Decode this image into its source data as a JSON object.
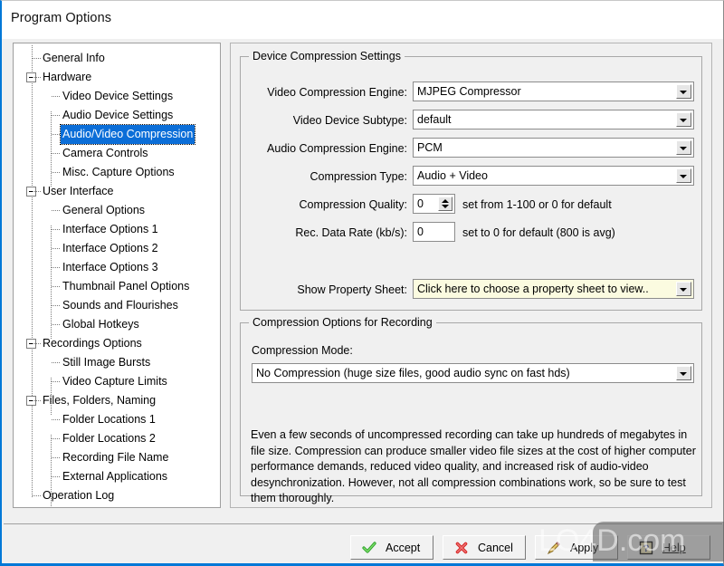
{
  "window": {
    "title": "Program Options",
    "accent_color": "#0078d7"
  },
  "tree": {
    "selected_color": "#0b6ed8",
    "items": [
      {
        "label": "General Info",
        "level": 0,
        "expander": false,
        "selected": false
      },
      {
        "label": "Hardware",
        "level": 0,
        "expander": true,
        "selected": false
      },
      {
        "label": "Video Device Settings",
        "level": 1,
        "expander": false,
        "selected": false
      },
      {
        "label": "Audio Device Settings",
        "level": 1,
        "expander": false,
        "selected": false
      },
      {
        "label": "Audio/Video Compression",
        "level": 1,
        "expander": false,
        "selected": true
      },
      {
        "label": "Camera Controls",
        "level": 1,
        "expander": false,
        "selected": false
      },
      {
        "label": "Misc. Capture Options",
        "level": 1,
        "expander": false,
        "selected": false
      },
      {
        "label": "User Interface",
        "level": 0,
        "expander": true,
        "selected": false
      },
      {
        "label": "General Options",
        "level": 1,
        "expander": false,
        "selected": false
      },
      {
        "label": "Interface Options 1",
        "level": 1,
        "expander": false,
        "selected": false
      },
      {
        "label": "Interface Options 2",
        "level": 1,
        "expander": false,
        "selected": false
      },
      {
        "label": "Interface Options 3",
        "level": 1,
        "expander": false,
        "selected": false
      },
      {
        "label": "Thumbnail Panel Options",
        "level": 1,
        "expander": false,
        "selected": false
      },
      {
        "label": "Sounds and Flourishes",
        "level": 1,
        "expander": false,
        "selected": false
      },
      {
        "label": "Global Hotkeys",
        "level": 1,
        "expander": false,
        "selected": false
      },
      {
        "label": "Recordings Options",
        "level": 0,
        "expander": true,
        "selected": false
      },
      {
        "label": "Still Image Bursts",
        "level": 1,
        "expander": false,
        "selected": false
      },
      {
        "label": "Video Capture Limits",
        "level": 1,
        "expander": false,
        "selected": false
      },
      {
        "label": "Files, Folders, Naming",
        "level": 0,
        "expander": true,
        "selected": false
      },
      {
        "label": "Folder Locations 1",
        "level": 1,
        "expander": false,
        "selected": false
      },
      {
        "label": "Folder Locations 2",
        "level": 1,
        "expander": false,
        "selected": false
      },
      {
        "label": "Recording File Name",
        "level": 1,
        "expander": false,
        "selected": false
      },
      {
        "label": "External Applications",
        "level": 1,
        "expander": false,
        "selected": false
      },
      {
        "label": "Operation Log",
        "level": 0,
        "expander": false,
        "selected": false
      }
    ]
  },
  "device_group": {
    "title": "Device Compression Settings",
    "video_engine": {
      "label": "Video Compression Engine:",
      "value": "MJPEG Compressor"
    },
    "video_subtype": {
      "label": "Video Device Subtype:",
      "value": "default"
    },
    "audio_engine": {
      "label": "Audio Compression Engine:",
      "value": "PCM"
    },
    "compression_type": {
      "label": "Compression Type:",
      "value": "Audio + Video"
    },
    "quality": {
      "label": "Compression Quality:",
      "value": "0",
      "hint": "set from 1-100 or 0 for default"
    },
    "data_rate": {
      "label": "Rec. Data Rate (kb/s):",
      "value": "0",
      "hint": "set to 0 for default (800 is avg)"
    },
    "property_sheet": {
      "label": "Show Property Sheet:",
      "value": "Click here to choose a property sheet to view..",
      "background_color": "#fbfbe0"
    }
  },
  "compression_group": {
    "title": "Compression Options for Recording",
    "mode_label": "Compression Mode:",
    "mode_value": "No Compression (huge size files, good audio sync on fast hds)",
    "description": "Even a few seconds of uncompressed recording can take up hundreds of megabytes in file size.  Compression can produce smaller video file sizes at the cost of higher computer performance demands, reduced video quality, and increased risk of audio-video desynchronization.  However, not all compression combinations work, so be sure to test them thoroughly."
  },
  "footer": {
    "accept": "Accept",
    "cancel": "Cancel",
    "apply": "Apply",
    "help": "Help"
  },
  "watermark": {
    "text": "LO4D.com"
  }
}
